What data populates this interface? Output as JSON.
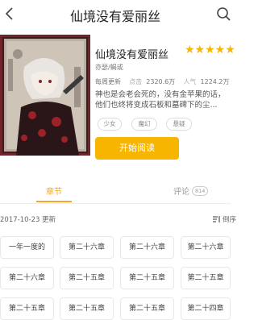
{
  "header": {
    "title": "仙境没有爱丽丝",
    "back_icon": "chevron-left-icon",
    "search_icon": "search-icon"
  },
  "book": {
    "title": "仙境没有爱丽丝",
    "rating_stars": 5,
    "stars_text": "★★★★★",
    "author": "亦瑟/蝎或",
    "update_label": "每周更新",
    "clicks_label": "点击",
    "clicks_value": "2320.6万",
    "popularity_label": "人气",
    "popularity_value": "1224.2万",
    "desc_line1": "神也是会老会死的，没有金苹果的话，",
    "desc_line2": "他们也终将变成石板和墓碑下的尘...",
    "tags": [
      "少女",
      "魔幻",
      "悬疑"
    ],
    "read_button": "开始阅读"
  },
  "tabs": {
    "chapters": "章节",
    "comments": "评论",
    "comment_count": "814"
  },
  "chapter_list": {
    "update_text": "2017-10-23 更新",
    "sort_label": "倒序",
    "chapters": [
      "一年一度的",
      "第二十六章",
      "第二十六章",
      "第二十六章",
      "第二十六章",
      "第二十五章",
      "第二十五章",
      "第二十五章",
      "第二十五章",
      "第二十五章",
      "第二十五章",
      "第二十四章"
    ]
  },
  "colors": {
    "accent": "#f7b500",
    "tab_active": "#f5a623",
    "cover_bg": "#7d2a2c"
  }
}
